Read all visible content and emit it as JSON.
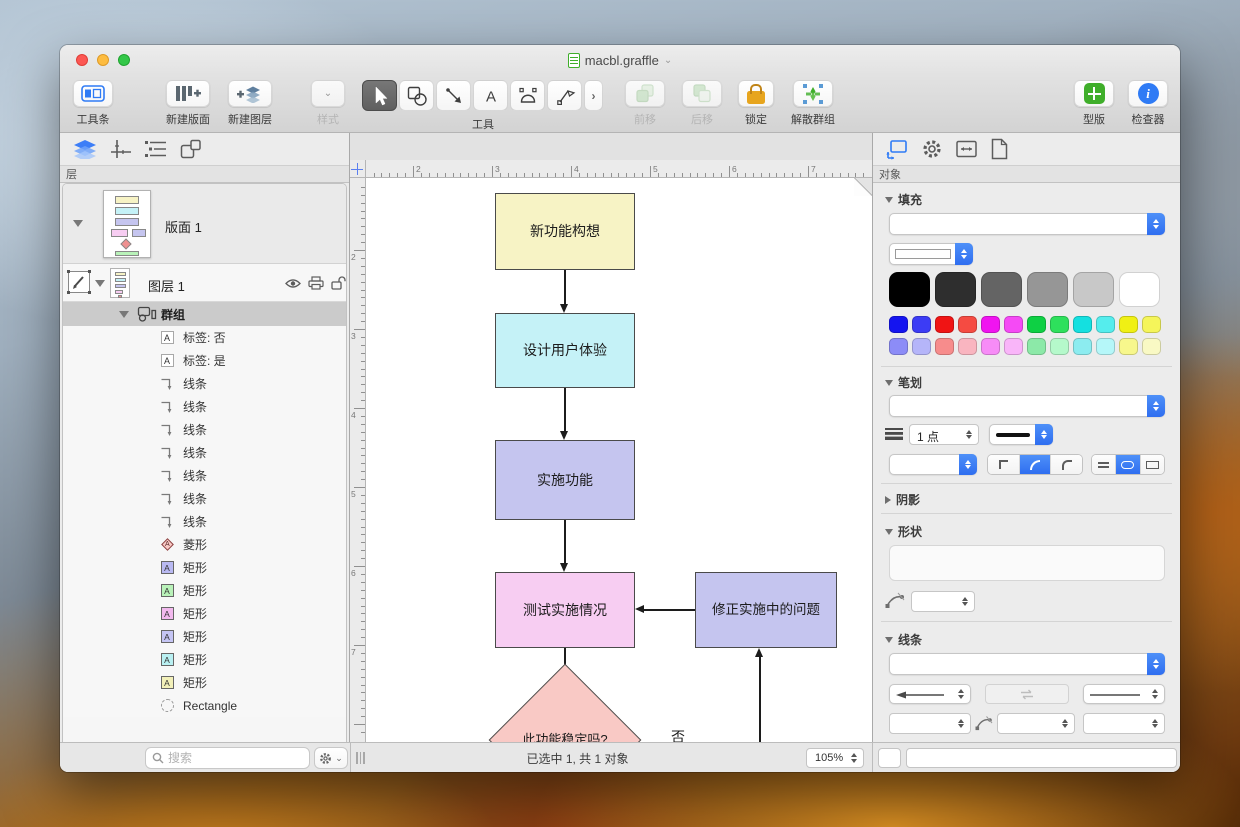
{
  "window": {
    "title": "macbl.graffle"
  },
  "toolbar": {
    "toolbar_btn": "工具条",
    "new_canvas": "新建版面",
    "new_layer": "新建图层",
    "style": "样式",
    "tools": "工具",
    "bring_forward": "前移",
    "send_backward": "后移",
    "lock": "锁定",
    "ungroup": "解散群组",
    "stencils": "型版",
    "inspector": "检查器"
  },
  "sidebar": {
    "panel_title": "层",
    "canvas_name": "版面 1",
    "layer_name": "图层 1",
    "group_name": "群组",
    "items": [
      {
        "icon": "label",
        "label": "标签: 否"
      },
      {
        "icon": "label",
        "label": "标签: 是"
      },
      {
        "icon": "line",
        "label": "线条"
      },
      {
        "icon": "line",
        "label": "线条"
      },
      {
        "icon": "line",
        "label": "线条"
      },
      {
        "icon": "line",
        "label": "线条"
      },
      {
        "icon": "line",
        "label": "线条"
      },
      {
        "icon": "line",
        "label": "线条"
      },
      {
        "icon": "line",
        "label": "线条"
      },
      {
        "icon": "diamond",
        "label": "菱形",
        "color": "#f9c9c5"
      },
      {
        "icon": "rect",
        "label": "矩形",
        "color": "#b9b9f2"
      },
      {
        "icon": "rect",
        "label": "矩形",
        "color": "#b9f2b9"
      },
      {
        "icon": "rect",
        "label": "矩形",
        "color": "#f2b9ee"
      },
      {
        "icon": "rect",
        "label": "矩形",
        "color": "#c5c5f4"
      },
      {
        "icon": "rect",
        "label": "矩形",
        "color": "#b9f0f2"
      },
      {
        "icon": "rect",
        "label": "矩形",
        "color": "#f2f0b9"
      },
      {
        "icon": "dashed",
        "label": "Rectangle"
      }
    ],
    "search_placeholder": "搜索"
  },
  "canvas": {
    "h_ruler": [
      "2",
      "3",
      "4",
      "5",
      "6",
      "7"
    ],
    "v_ruler": [
      "2",
      "3",
      "4",
      "5",
      "6",
      "7"
    ],
    "nodes": [
      {
        "label": "新功能构想",
        "color": "#f7f3c5"
      },
      {
        "label": "设计用户体验",
        "color": "#c5f2f7"
      },
      {
        "label": "实施功能",
        "color": "#c5c5ef"
      },
      {
        "label": "测试实施情况",
        "color": "#f7cdf2"
      },
      {
        "label": "修正实施中的问题",
        "color": "#c5c5ef"
      },
      {
        "label": "此功能稳定吗?",
        "color": "#f9c9c5"
      }
    ],
    "edge_label_no": "否"
  },
  "inspector": {
    "panel_title": "对象",
    "sections": {
      "fill": "填充",
      "stroke": "笔划",
      "shadow": "阴影",
      "shape": "形状",
      "lines": "线条"
    },
    "stroke_width": "1 点",
    "palette_large": [
      "#000000",
      "#2e2e2e",
      "#646464",
      "#969696",
      "#c8c8c8",
      "#ffffff"
    ],
    "palette_bright": [
      "#1414f0",
      "#3c3cf5",
      "#f01414",
      "#f54b42",
      "#f014f0",
      "#f54af5",
      "#0ed044",
      "#2ee05c",
      "#14e0e0",
      "#55eded",
      "#f0f014",
      "#f5f55a"
    ],
    "palette_pastel": [
      "#8c8cf7",
      "#b5b5f9",
      "#f78c8c",
      "#f9b5c0",
      "#f78cf7",
      "#f9b5f9",
      "#8ce9a8",
      "#b5f9cb",
      "#8cecf0",
      "#b5f7f9",
      "#f7f78c",
      "#f9f9c4"
    ]
  },
  "statusbar": {
    "status": "已选中 1, 共 1 对象",
    "zoom": "105%"
  }
}
